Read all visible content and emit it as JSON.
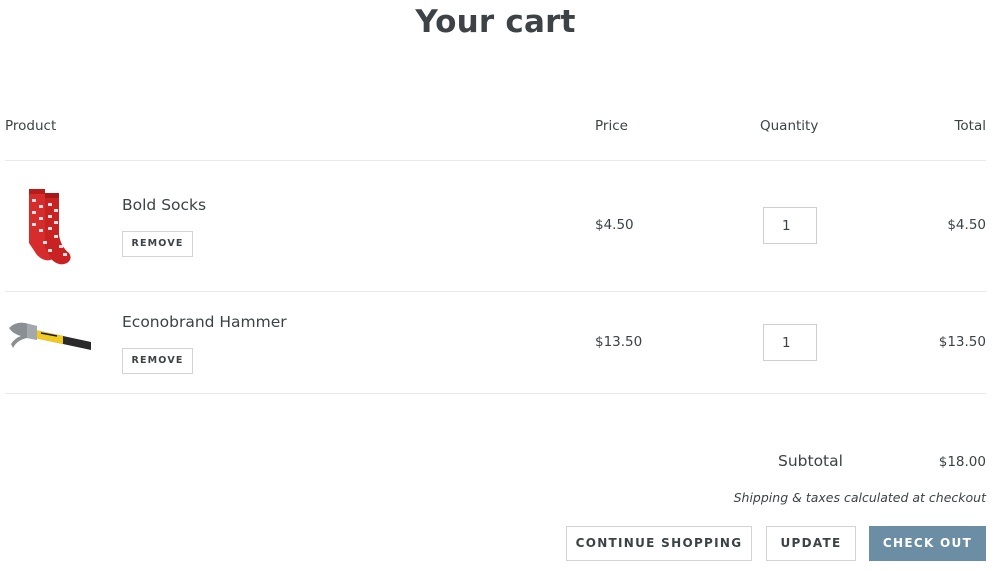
{
  "page": {
    "title": "Your cart"
  },
  "table": {
    "headers": {
      "product": "Product",
      "price": "Price",
      "quantity": "Quantity",
      "total": "Total"
    },
    "items": [
      {
        "name": "Bold Socks",
        "remove_label": "REMOVE",
        "price": "$4.50",
        "quantity": "1",
        "total": "$4.50",
        "image": "red-socks-image"
      },
      {
        "name": "Econobrand Hammer",
        "remove_label": "REMOVE",
        "price": "$13.50",
        "quantity": "1",
        "total": "$13.50",
        "image": "hammer-image"
      }
    ]
  },
  "summary": {
    "subtotal_label": "Subtotal",
    "subtotal_value": "$18.00",
    "shipping_note": "Shipping & taxes calculated at checkout"
  },
  "actions": {
    "continue_label": "CONTINUE SHOPPING",
    "update_label": "UPDATE",
    "checkout_label": "CHECK OUT"
  },
  "colors": {
    "text": "#3d4246",
    "accent": "#6b8ea4",
    "border": "#e8e9eb",
    "socks": "#d62c2c"
  }
}
